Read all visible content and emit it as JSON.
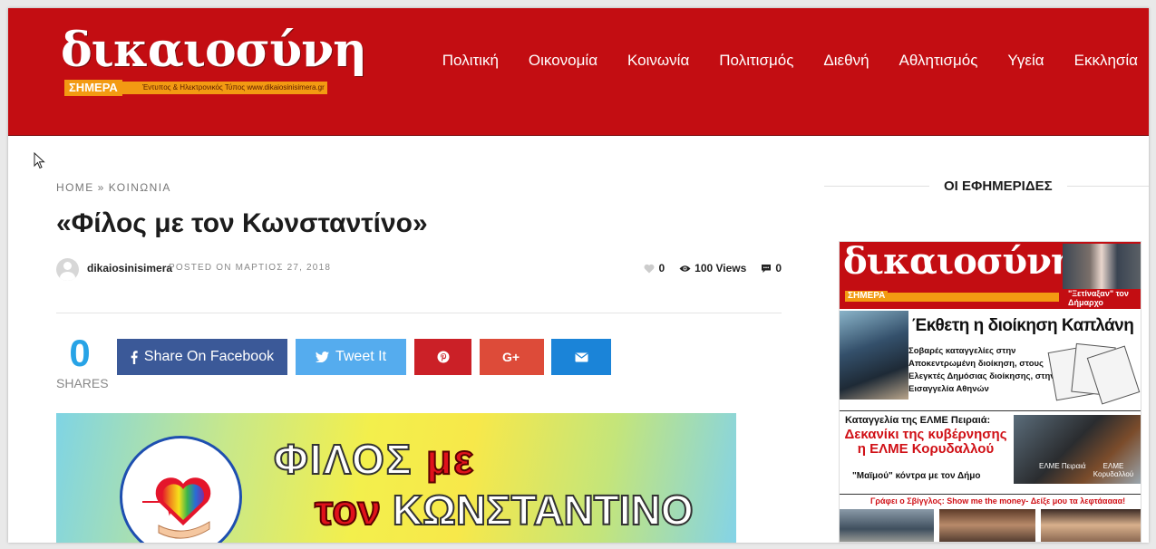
{
  "site": {
    "logo_word": "δικαιοσύνη",
    "logo_sub": "ΣΗΜΕΡΑ",
    "logo_tag": "Έντυπος & Ηλεκτρονικός Τύπος  www.dikaiosinisimera.gr"
  },
  "nav": [
    "Πολιτική",
    "Οικονομία",
    "Κοινωνία",
    "Πολιτισμός",
    "Διεθνή",
    "Αθλητισμός",
    "Υγεία",
    "Εκκλησία"
  ],
  "breadcrumb": {
    "home": "HOME",
    "separator": "»",
    "current": "ΚΟΙΝΩΝΙΑ"
  },
  "article": {
    "title": "«Φίλος με τον Κωνσταντίνο»",
    "author": "dikaiosinisimera",
    "posted": "POSTED ON ΜΑΡΤΙΟΣ 27, 2018",
    "likes": "0",
    "views": "100 Views",
    "comments": "0"
  },
  "share": {
    "count": "0",
    "label": "SHARES",
    "facebook": "Share On Facebook",
    "twitter": "Tweet It"
  },
  "banner": {
    "line1_a": "ΦΙΛΟΣ ",
    "line1_b": "με",
    "line2_a": "τον ",
    "line2_b": "ΚΩΝΣΤΑΝΤΙΝΟ"
  },
  "sidebar": {
    "title": "ΟΙ ΕΦΗΜΕΡΙΔΕΣ",
    "paper": {
      "word": "δικαιοσύνη",
      "sub": "ΣΗΜΕΡΑ",
      "top_tag": "\"Ξετίναξαν\" τον Δήμαρχο",
      "headline1": "Έκθετη η διοίκηση Καπλάνη",
      "text1": "Σοβαρές καταγγελίες στην Αποκεντρωμένη διοίκηση, στους Ελεγκτές Δημόσιας διοίκησης, στην Εισαγγελία Αθηνών",
      "headline2a": "Καταγγελία της ΕΛΜΕ Πειραιά:",
      "headline2b": "Δεκανίκι της κυβέρνησης η ΕΛΜΕ Κορυδαλλού",
      "headline2c": "\"Μαϊμού\" κόντρα με τον Δήμο",
      "photo_label_left": "ΕΛΜΕ Πειραιά",
      "photo_label_right": "ΕΛΜΕ Κορυδαλλού",
      "headline3": "Γράφει ο Σβίγγλος: Show me the money- Δείξε μου τα λεφτάαααα!"
    }
  },
  "colors": {
    "header_red": "#c30d12",
    "facebook": "#3b5998",
    "twitter": "#55acee",
    "pinterest": "#cb2027",
    "google_plus": "#dd4b39",
    "email": "#1b84d8",
    "shares_blue": "#27a3e6"
  }
}
